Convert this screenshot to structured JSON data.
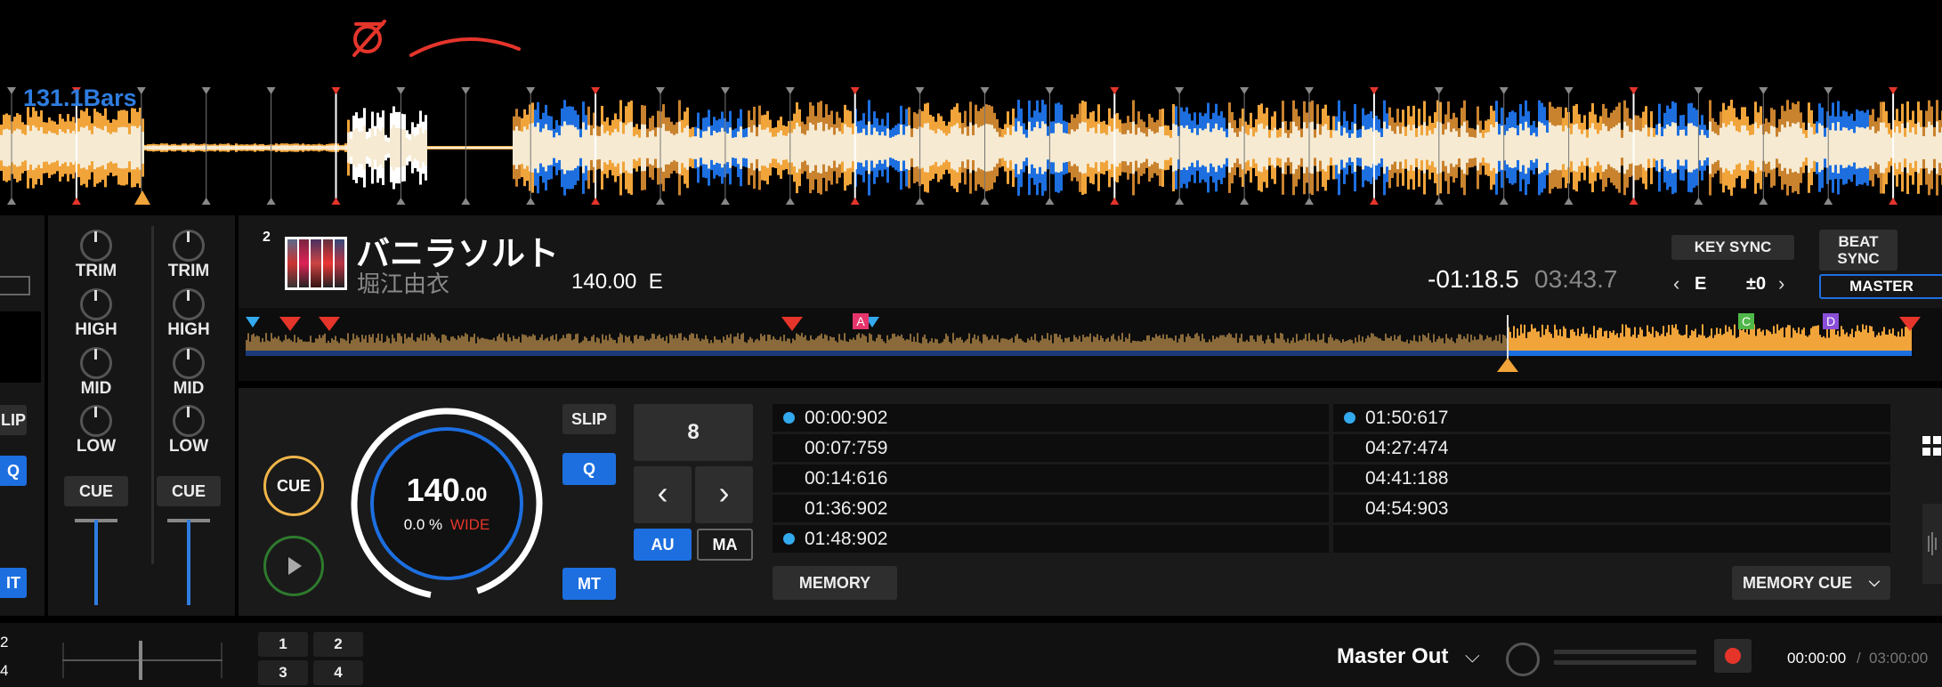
{
  "top_waveform": {
    "bars_label": "131.1Bars",
    "annotation_symbol": "∅"
  },
  "deck": {
    "number": "2",
    "title": "バニラソルト",
    "artist": "堀江由衣",
    "bpm_key": "140.00  E",
    "remaining_time": "-01:18.5",
    "total_time": "03:43.7",
    "key_sync_label": "KEY SYNC",
    "key_value": "E",
    "key_shift": "±0",
    "beat_sync_label": "BEAT\nSYNC",
    "master_label": "MASTER",
    "overview_markers": [
      "A",
      "C",
      "D"
    ]
  },
  "mixer": {
    "channels": [
      {
        "trim": "TRIM",
        "high": "HIGH",
        "mid": "MID",
        "low": "LOW",
        "cue": "CUE"
      },
      {
        "trim": "TRIM",
        "high": "HIGH",
        "mid": "MID",
        "low": "LOW",
        "cue": "CUE"
      }
    ]
  },
  "left_strip": {
    "slip": "LIP",
    "q": "Q",
    "mt": "IT"
  },
  "transport": {
    "cue_label": "CUE",
    "bpm_int": "140",
    "bpm_dec": ".00",
    "pitch": "0.0 %",
    "pitch_range": "WIDE",
    "slip_label": "SLIP",
    "q_label": "Q",
    "mt_label": "MT"
  },
  "beat_jump": {
    "value": "8",
    "prev": "‹",
    "next": "›",
    "au_label": "AU",
    "ma_label": "MA"
  },
  "hot_cues": {
    "left": [
      "00:00:902",
      "00:07:759",
      "00:14:616",
      "01:36:902",
      "01:48:902"
    ],
    "right": [
      "01:50:617",
      "04:27:474",
      "04:41:188",
      "04:54:903",
      ""
    ],
    "memory_label": "MEMORY",
    "memory_cue_label": "MEMORY CUE"
  },
  "bottom_bar": {
    "left_nums": [
      "2",
      "4"
    ],
    "pads": [
      "1",
      "2",
      "3",
      "4"
    ],
    "output_label": "Master Out",
    "rec_time": "00:00:00",
    "rec_separator": "/",
    "rec_total": "03:00:00"
  },
  "colors": {
    "accent_blue": "#1d6fe0",
    "waveform_orange": "#f0a43a",
    "waveform_cream": "#f6ead2",
    "cue_marker_red": "#e5352b",
    "cue_dot": "#33a9ee"
  }
}
